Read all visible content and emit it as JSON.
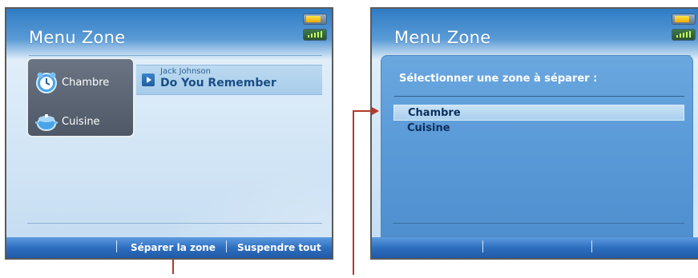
{
  "screens": [
    {
      "title": "Menu Zone",
      "zones": [
        {
          "label": "Chambre",
          "icon": "alarm-clock-icon"
        },
        {
          "label": "Cuisine",
          "icon": "cooking-pot-icon"
        }
      ],
      "now_playing": {
        "artist": "Jack Johnson",
        "track": "Do You Remember",
        "icon": "play-icon"
      },
      "softkeys": [
        "",
        "Séparer la zone",
        "Suspendre tout"
      ]
    },
    {
      "title": "Menu Zone",
      "dialog": {
        "prompt": "Sélectionner une zone à séparer :",
        "options": [
          "Chambre",
          "Cuisine"
        ],
        "selected_index": 0
      },
      "softkeys": [
        "",
        "",
        ""
      ]
    }
  ],
  "status": {
    "battery_icon": "battery-icon",
    "signal_icon": "signal-strength-icon"
  },
  "colors": {
    "accent": "#2f6fc0",
    "pointer": "#b23a2a",
    "dialog": "#5a9ad7"
  }
}
